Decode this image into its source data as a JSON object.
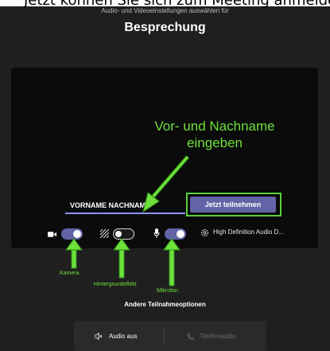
{
  "caption": "Jetzt können Sie sich zum Meeting anmelden",
  "header": {
    "subtitle": "Audio- und Videoeinstellungen auswählen für",
    "title": "Besprechung"
  },
  "annotation": {
    "line1": "Vor- und Nachname",
    "line2": "eingeben"
  },
  "join": {
    "name_value": "VORNAME NACHNAME",
    "button_label": "Jetzt teilnehmen"
  },
  "controls": {
    "camera_on": true,
    "background_effect_on": false,
    "mic_on": true,
    "audio_device": "High Definition Audio D..."
  },
  "labels": {
    "camera": "Kamera",
    "background": "Hintergrundeffekt",
    "mic": "Mikrofon"
  },
  "other_options": "Andere Teilnahmeoptionen",
  "audio_options": {
    "audio_off": "Audio aus",
    "phone_audio": "Telefonaudio"
  },
  "colors": {
    "accent": "#6264a7",
    "annotation_green": "#6ee03a"
  }
}
